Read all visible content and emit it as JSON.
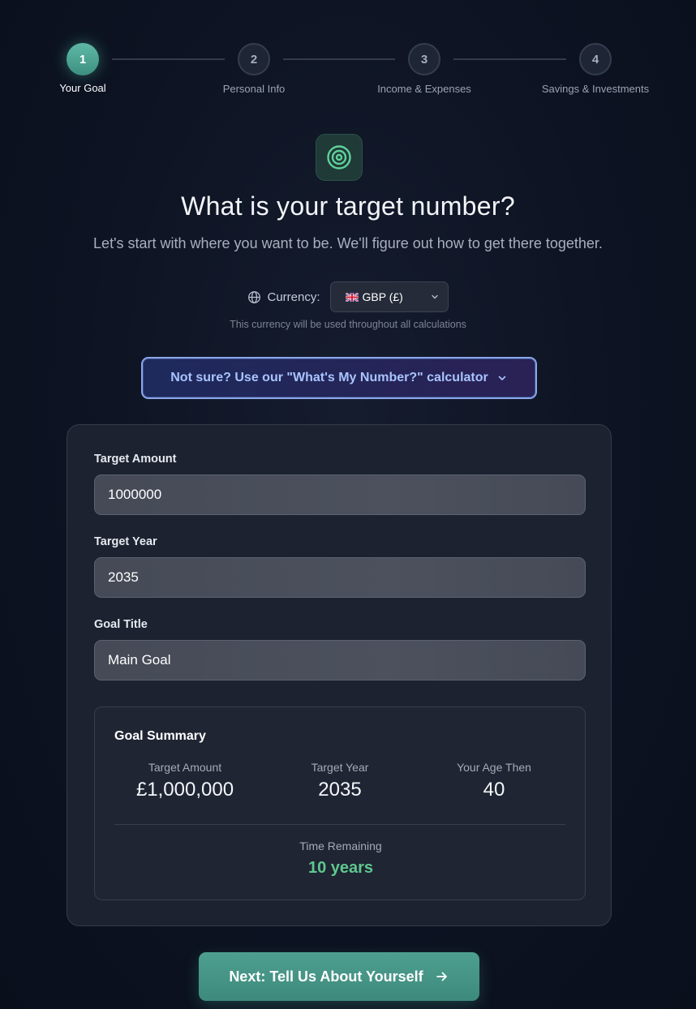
{
  "stepper": {
    "steps": [
      {
        "number": "1",
        "label": "Your Goal"
      },
      {
        "number": "2",
        "label": "Personal Info"
      },
      {
        "number": "3",
        "label": "Income & Expenses"
      },
      {
        "number": "4",
        "label": "Savings & Investments"
      }
    ],
    "active_step": 1
  },
  "header": {
    "icon": "target-icon",
    "title": "What is your target number?",
    "subtitle": "Let's start with where you want to be. We'll figure out how to get there together."
  },
  "currency": {
    "label": "Currency:",
    "selected": "GBP (£)",
    "note": "This currency will be used throughout all calculations"
  },
  "calculator_button": {
    "label": "Not sure? Use our \"What's My Number?\" calculator"
  },
  "form": {
    "target_amount": {
      "label": "Target Amount",
      "value": "1000000"
    },
    "target_year": {
      "label": "Target Year",
      "value": "2035"
    },
    "goal_title": {
      "label": "Goal Title",
      "value": "Main Goal"
    }
  },
  "summary": {
    "title": "Goal Summary",
    "target_amount": {
      "label": "Target Amount",
      "value": "£1,000,000"
    },
    "target_year": {
      "label": "Target Year",
      "value": "2035"
    },
    "age_then": {
      "label": "Your Age Then",
      "value": "40"
    },
    "time_remaining": {
      "label": "Time Remaining",
      "value": "10 years"
    }
  },
  "next_button": {
    "label": "Next: Tell Us About Yourself"
  },
  "colors": {
    "accent": "#4e9f90",
    "success": "#5ec98e",
    "calc_text": "#a9c4ff",
    "background": "#0d1322"
  }
}
